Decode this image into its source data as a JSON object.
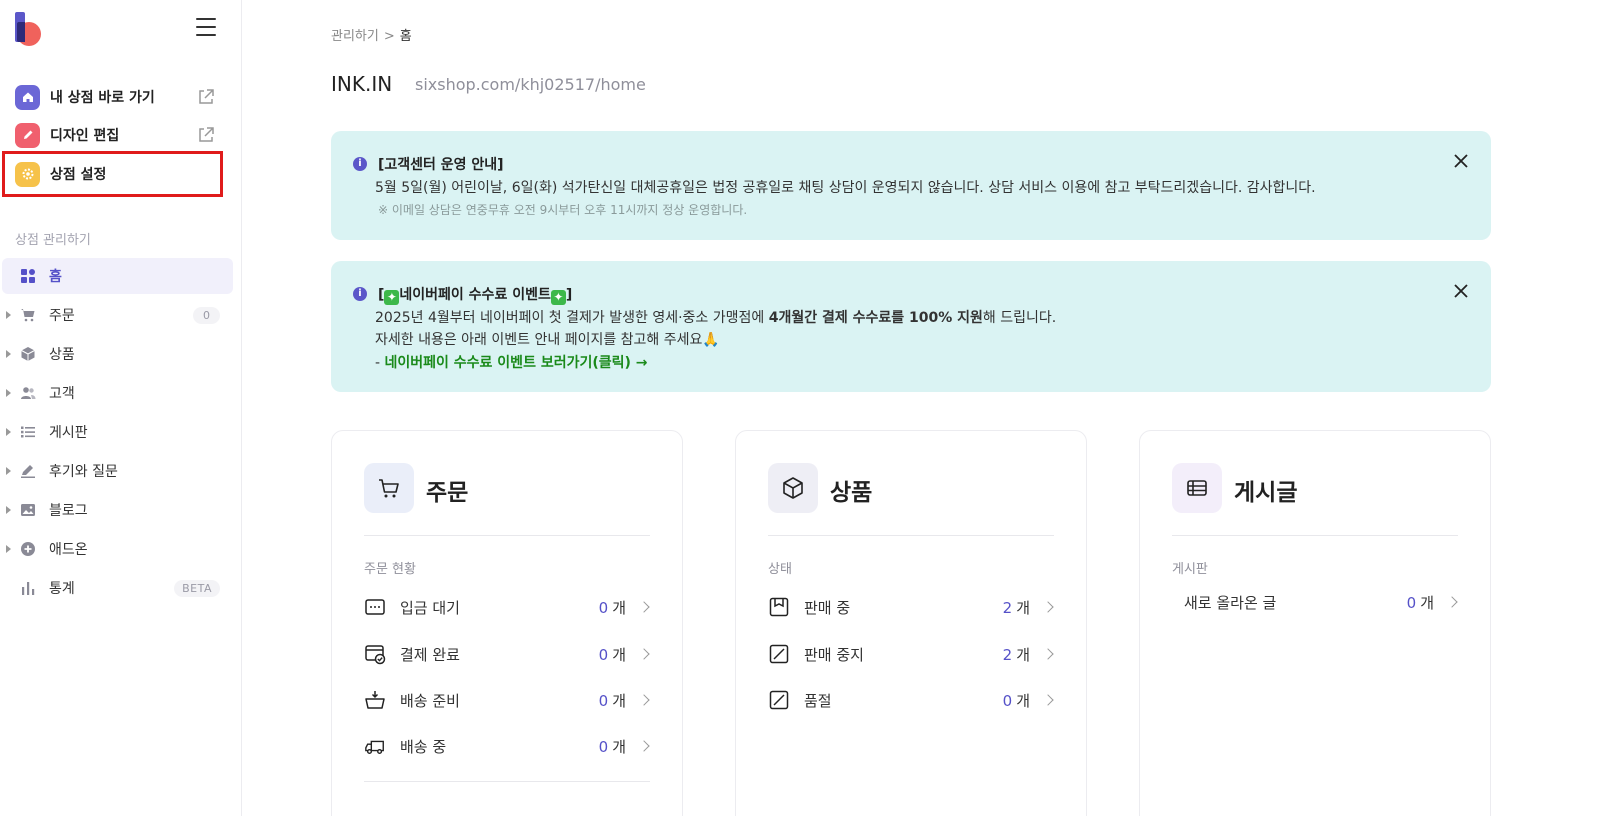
{
  "sidebar": {
    "quick_links": [
      {
        "label": "내 상점 바로 가기",
        "icon": "home-icon",
        "color": "#6b67d6"
      },
      {
        "label": "디자인 편집",
        "icon": "pencil-icon",
        "color": "#f0606e"
      },
      {
        "label": "상점 설정",
        "icon": "gear-icon",
        "color": "#f6c24a"
      }
    ],
    "section_label": "상점 관리하기",
    "nav": [
      {
        "label": "홈",
        "icon": "grid-icon",
        "active": true
      },
      {
        "label": "주문",
        "icon": "cart-icon",
        "badge": "0"
      },
      {
        "label": "상품",
        "icon": "box-icon"
      },
      {
        "label": "고객",
        "icon": "users-icon"
      },
      {
        "label": "게시판",
        "icon": "list-icon"
      },
      {
        "label": "후기와 질문",
        "icon": "edit-icon"
      },
      {
        "label": "블로그",
        "icon": "image-icon"
      },
      {
        "label": "애드온",
        "icon": "plus-circle-icon"
      },
      {
        "label": "통계",
        "icon": "bar-chart-icon",
        "badge": "BETA"
      }
    ]
  },
  "breadcrumb": {
    "parent": "관리하기",
    "separator": ">",
    "current": "홈"
  },
  "store": {
    "name": "INK.IN",
    "url": "sixshop.com/khj02517/home"
  },
  "notices": [
    {
      "title": "[고객센터 운영 안내]",
      "line1": "5월 5일(월) 어린이날, 6일(화) 석가탄신일 대체공휴일은 법정 공휴일로 채팅 상담이 운영되지 않습니다. 상담 서비스 이용에 참고 부탁드리겠습니다. 감사합니다.",
      "sub": "※ 이메일 상담은 연중무휴 오전 9시부터 오후 11시까지 정상 운영합니다."
    },
    {
      "title_pre": "[",
      "title_mid": "네이버페이 수수료 이벤트",
      "title_post": "]",
      "line1_a": "2025년 4월부터 네이버페이 첫 결제가 발생한 영세·중소 가맹점에 ",
      "line1_b": "4개월간 결제 수수료를 100% 지원",
      "line1_c": "해 드립니다.",
      "line2": "자세한 내용은 아래 이벤트 안내 페이지를 참고해 주세요🙏",
      "link_prefix": "- ",
      "link_text": "네이버페이 수수료 이벤트 보러가기(클릭) →"
    }
  ],
  "cards": {
    "orders": {
      "title": "주문",
      "sub": "주문 현황",
      "rows": [
        {
          "label": "입금 대기",
          "count": "0",
          "unit": "개"
        },
        {
          "label": "결제 완료",
          "count": "0",
          "unit": "개"
        },
        {
          "label": "배송 준비",
          "count": "0",
          "unit": "개"
        },
        {
          "label": "배송 중",
          "count": "0",
          "unit": "개"
        }
      ]
    },
    "products": {
      "title": "상품",
      "sub": "상태",
      "rows": [
        {
          "label": "판매 중",
          "count": "2",
          "unit": "개"
        },
        {
          "label": "판매 중지",
          "count": "2",
          "unit": "개"
        },
        {
          "label": "품절",
          "count": "0",
          "unit": "개"
        }
      ]
    },
    "posts": {
      "title": "게시글",
      "sub": "게시판",
      "rows": [
        {
          "label": "새로 올라온 글",
          "count": "0",
          "unit": "개"
        }
      ]
    }
  },
  "colors": {
    "accent": "#5551c8",
    "notice_bg": "#daf3f3",
    "highlight": "#e01b1b"
  }
}
